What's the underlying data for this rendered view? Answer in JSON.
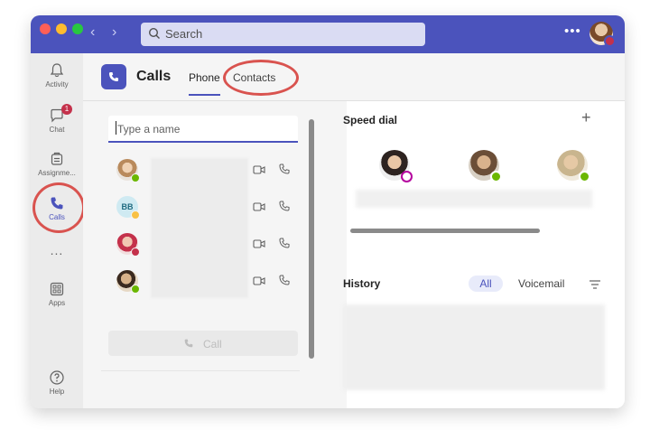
{
  "window": {
    "titlebar_color": "#4b53bc",
    "accent": "#4b53bc"
  },
  "search": {
    "placeholder": "Search"
  },
  "rail": {
    "items": [
      {
        "label": "Activity",
        "icon": "bell-icon"
      },
      {
        "label": "Chat",
        "icon": "chat-icon",
        "badge": "1"
      },
      {
        "label": "Assignme...",
        "icon": "assignments-icon"
      },
      {
        "label": "Calls",
        "icon": "phone-icon",
        "active": true
      },
      {
        "label": "...",
        "icon": "more-icon"
      },
      {
        "label": "Apps",
        "icon": "apps-icon"
      },
      {
        "label": "Help",
        "icon": "help-icon"
      }
    ]
  },
  "header": {
    "title": "Calls",
    "tabs": [
      {
        "label": "Phone",
        "active": true
      },
      {
        "label": "Contacts"
      }
    ]
  },
  "phone": {
    "name_input_placeholder": "Type a name",
    "contacts": [
      {
        "avatar": "photo",
        "status": "available"
      },
      {
        "avatar": "initials",
        "initials": "BB",
        "status": "away"
      },
      {
        "avatar": "photo",
        "status": "busy"
      },
      {
        "avatar": "photo",
        "status": "available"
      }
    ],
    "call_button": "Call"
  },
  "speed_dial": {
    "title": "Speed dial",
    "add_icon": "plus-icon",
    "people": [
      {
        "status": "do-not-disturb"
      },
      {
        "status": "available"
      },
      {
        "status": "available"
      }
    ]
  },
  "history": {
    "title": "History",
    "filters": [
      "All",
      "Voicemail"
    ],
    "active_filter": "All"
  }
}
